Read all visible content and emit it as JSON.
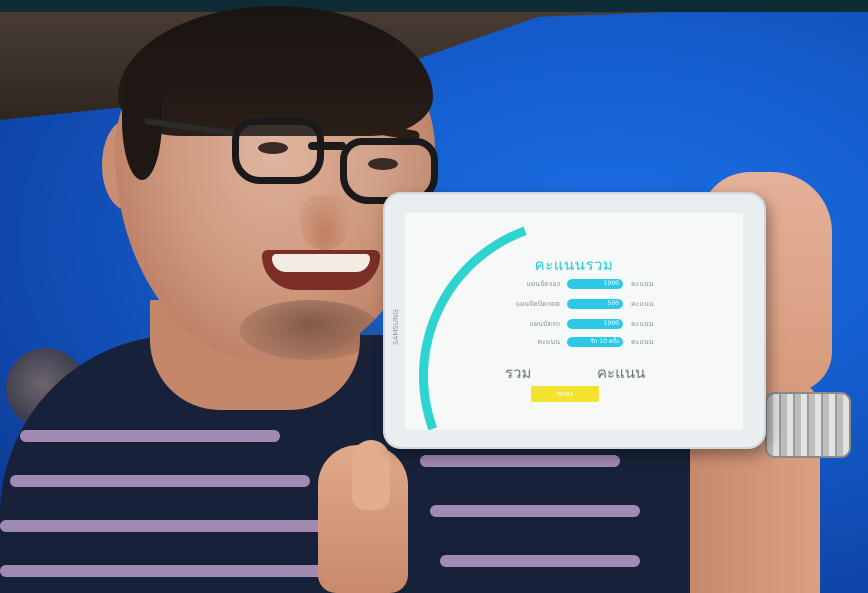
{
  "scene": {
    "background_color": "#155fd0",
    "accent_color": "#2dd4d0"
  },
  "tablet": {
    "brand": "SAMSUNG",
    "screen": {
      "title": "คะแนนรวม",
      "rows": [
        {
          "label": "แผนจัดรอง",
          "value": "1000",
          "unit": "คะแนน"
        },
        {
          "label": "แผนจัดบัดกตต",
          "value": "500",
          "unit": "คะแนน"
        },
        {
          "label": "แผนบัดรถ",
          "value": "1000",
          "unit": "คะแนน"
        },
        {
          "label": "คะแนน",
          "value": "รัก 10 ครั้ง",
          "unit": "คะแนน"
        }
      ],
      "total_label": "รวม",
      "total_unit": "คะแนน",
      "button_label": "ตกลง"
    }
  }
}
